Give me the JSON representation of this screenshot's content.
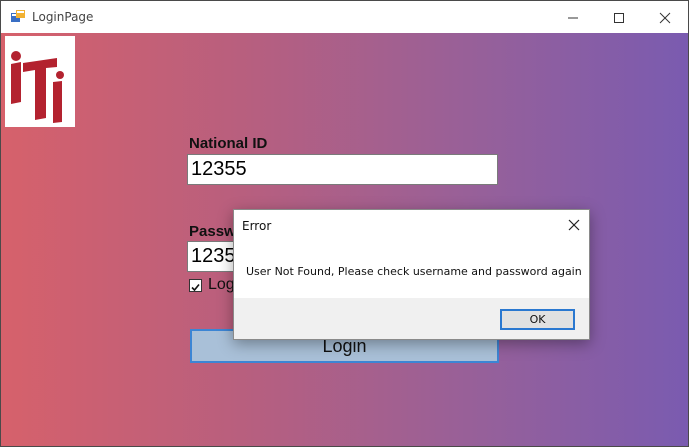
{
  "window": {
    "title": "LoginPage",
    "icon": "winforms-app-icon",
    "controls": [
      "minimize-icon",
      "maximize-icon",
      "close-icon"
    ]
  },
  "logo": {
    "text": "ITI",
    "color": "#b3222f"
  },
  "form": {
    "national_id_label": "National ID",
    "national_id_value": "12355",
    "password_label": "Passw",
    "password_value": "1235",
    "checkbox_checked": true,
    "checkbox_label": "Log",
    "login_button": "Login"
  },
  "colors": {
    "gradient_left": "#d6616b",
    "gradient_right": "#7a5bb0",
    "login_button_bg": "#a9c0d8",
    "focus_border": "#3c85d4"
  },
  "dialog": {
    "title": "Error",
    "message": "User Not Found, Please check username and password again",
    "ok_button": "OK"
  }
}
